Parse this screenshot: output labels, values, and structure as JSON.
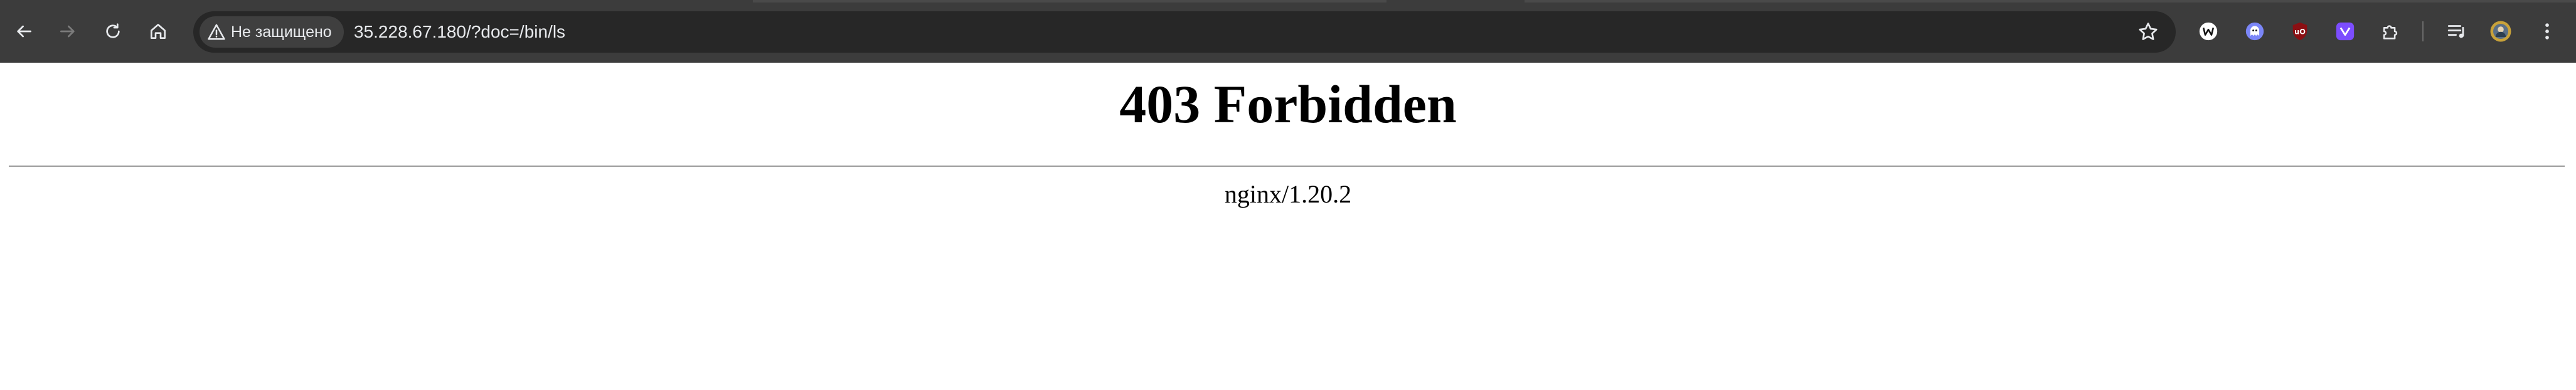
{
  "browser": {
    "security_label": "Не защищено",
    "url": "35.228.67.180/?doc=/bin/ls",
    "theme": {
      "toolbar": "#3c3c3c",
      "omnibox": "#272727",
      "text": "#e8eaed"
    },
    "icons": {
      "back": "arrow-left-icon",
      "forward": "arrow-right-icon",
      "reload": "reload-icon",
      "home": "home-icon",
      "warning": "warning-triangle-icon",
      "bookmark": "star-icon",
      "extensions": [
        "w-circle-extension-icon",
        "ghost-extension-icon",
        "ublock-origin-icon",
        "purple-shield-extension-icon",
        "puzzle-piece-icon"
      ],
      "media": "media-queue-icon",
      "profile": "avatar",
      "menu": "kebab-menu-icon"
    }
  },
  "page": {
    "title": "403 Forbidden",
    "server": "nginx/1.20.2"
  }
}
